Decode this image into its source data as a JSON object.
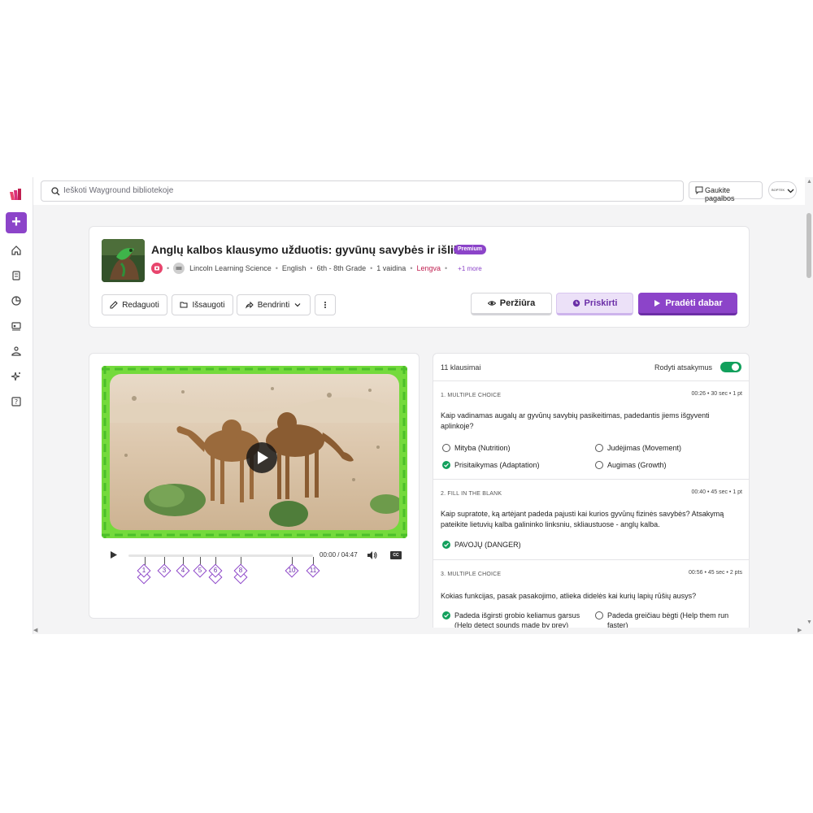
{
  "search": {
    "placeholder": "Ieškoti Wayground bibliotekoje"
  },
  "topbar": {
    "help_label": "Gaukite pagalbos",
    "profile_text": "BOPTEK"
  },
  "sidebar": {
    "create_label": "+",
    "icons": [
      "home-icon",
      "library-icon",
      "reports-icon",
      "classes-icon",
      "accommodations-icon",
      "ai-sparkle-icon",
      "help-icon"
    ]
  },
  "quiz": {
    "title": "Anglų kalbos klausymo užduotis: gyvūnų savybės ir išlikimas",
    "badge": "Premium",
    "meta": {
      "author": "Lincoln Learning Science",
      "language": "English",
      "grade": "6th - 8th Grade",
      "plays": "1 vaidina",
      "difficulty": "Lengva",
      "more": "+1 more"
    },
    "actions": {
      "edit": "Redaguoti",
      "save": "Išsaugoti",
      "share": "Bendrinti",
      "preview": "Peržiūra",
      "assign": "Priskirti",
      "start": "Pradėti dabar"
    }
  },
  "player": {
    "time": "00:00 / 04:47",
    "cc": "CC",
    "markers": [
      "1",
      "3",
      "4",
      "5",
      "6",
      "8",
      "10",
      "11"
    ]
  },
  "questions_panel": {
    "count": "11 klausimai",
    "show_answers": "Rodyti atsakymus",
    "show_answers_on": true,
    "questions": [
      {
        "type": "1. MULTIPLE CHOICE",
        "info": "00:26 • 30 sec • 1 pt",
        "text": "Kaip vadinamas augalų ar gyvūnų savybių pasikeitimas, padedantis jiems išgyventi aplinkoje?",
        "options": [
          {
            "label": "Mityba (Nutrition)",
            "correct": false
          },
          {
            "label": "Judėjimas (Movement)",
            "correct": false
          },
          {
            "label": "Prisitaikymas (Adaptation)",
            "correct": true
          },
          {
            "label": "Augimas (Growth)",
            "correct": false
          }
        ]
      },
      {
        "type": "2. FILL IN THE BLANK",
        "info": "00:40 • 45 sec • 1 pt",
        "text": "Kaip supratote, ką artėjant padeda pajusti kai kurios gyvūnų fizinės savybės? Atsakymą pateikite lietuvių kalba galininko linksniu, skliaustuose - anglų kalba.",
        "options": [
          {
            "label": "PAVOJŲ (DANGER)",
            "correct": true
          }
        ]
      },
      {
        "type": "3. MULTIPLE CHOICE",
        "info": "00:56 • 45 sec • 2 pts",
        "text": "Kokias funkcijas, pasak pasakojimo, atlieka didelės kai kurių lapių rūšių ausys?",
        "options": [
          {
            "label": "Padeda išgirsti grobio keliamus garsus",
            "label2": "(Help detect sounds made by prey)",
            "correct": true
          },
          {
            "label": "Padeda greičiau bėgti (Help them run",
            "label2": "faster)",
            "correct": false
          }
        ]
      }
    ]
  }
}
